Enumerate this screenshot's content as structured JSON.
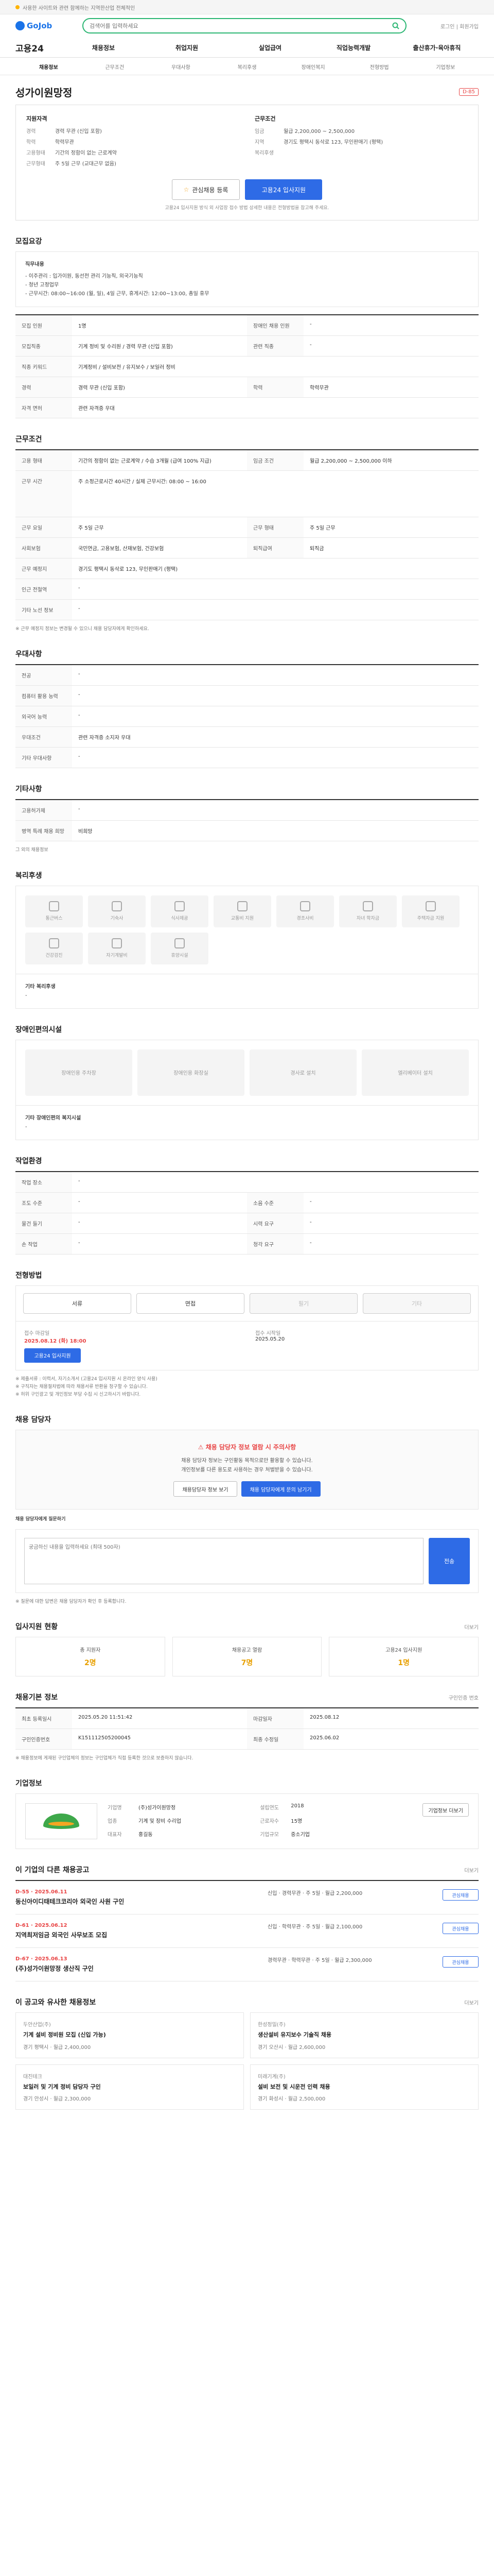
{
  "topbar": {
    "notice": "사용한 사이트와 관련 함께하는 지역한산업 전체적인"
  },
  "header": {
    "logo": "GoJob",
    "search_placeholder": "검색어를 입력하세요",
    "util": "로그인 | 회원가입"
  },
  "gnb": {
    "logo": "고용24",
    "items": [
      "채용정보",
      "취업지원",
      "실업급여",
      "직업능력개발",
      "출산휴가·육아휴직"
    ]
  },
  "subtabs": [
    "채용정보",
    "근무조건",
    "우대사항",
    "복리후생",
    "장애인복지",
    "전형방법",
    "기업정보"
  ],
  "title": {
    "text": "성가이원망정",
    "dday": "D-85"
  },
  "summary": {
    "left_h": "지원자격",
    "left": [
      {
        "k": "경력",
        "v": "경력 무관 (신입 포함)"
      },
      {
        "k": "학력",
        "v": "학력무관"
      },
      {
        "k": "고용형태",
        "v": "기간의 정함이 없는 근로계약"
      },
      {
        "k": "근무형태",
        "v": "주 5일 근무 (교대근무 없음)"
      }
    ],
    "right_h": "근무조건",
    "right": [
      {
        "k": "임금",
        "v": "월급 2,200,000 ~ 2,500,000"
      },
      {
        "k": "지역",
        "v": "경기도 평택시 동삭로 123, 무인판매기 (평택)"
      },
      {
        "k": "복리후생",
        "v": ""
      }
    ]
  },
  "buttons": {
    "interest": "관심채용 등록",
    "apply": "고용24 입사지원"
  },
  "notice_line": "고용24 입사지원 방식 외 사업장 접수 방법 상세한 내용은 전형방법을 참고해 주세요.",
  "sections": {
    "recruit": {
      "title": "모집요강",
      "boxed_h": "직무내용",
      "boxed_lines": [
        "- 이주관리 : 입가이원, 동선전 관리 기능직, 외국기능직",
        "- 청년 고정업무",
        "- 근무시간: 08:00~16:00 (월, 일), 4일 근무, 휴게시간: 12:00~13:00, 총일 휴무"
      ],
      "rows": [
        {
          "th": "모집 인원",
          "td": "1명",
          "th2": "장애인 채용 인원",
          "td2": "-"
        },
        {
          "th": "모집직종",
          "td": "기계 정비 및 수리원 / 경력 무관 (신입 포함)",
          "th2": "관련 직종",
          "td2": "-"
        },
        {
          "th": "직종 키워드",
          "td": "기계정비 / 설비보전 / 유지보수 / 보일러 정비"
        },
        {
          "th": "경력",
          "td": "경력 무관 (신입 포함)",
          "th2": "학력",
          "td2": "학력무관"
        },
        {
          "th": "자격 면허",
          "td": "관련 자격증 우대"
        }
      ]
    },
    "conditions": {
      "title": "근무조건",
      "rows": [
        {
          "th": "고용 형태",
          "td": "기간의 정함이 없는 근로계약 / 수습 3개월 (급여 100% 지급)",
          "th2": "임금 조건",
          "td2": "월급 2,200,000 ~ 2,500,000 이하"
        },
        {
          "th": "근무 시간",
          "td": "주 소정근로시간 40시간 / 실제 근무시간: 08:00 ~ 16:00"
        },
        {
          "th": "근무 요일",
          "td": "주 5일 근무",
          "th2": "근무 형태",
          "td2": "주 5일 근무"
        },
        {
          "th": "사회보험",
          "td": "국민연금, 고용보험, 산재보험, 건강보험",
          "th2": "퇴직급여",
          "td2": "퇴직금"
        },
        {
          "th": "근무 예정지",
          "td": "경기도 평택시 동삭로 123, 무인판매기 (평택)"
        },
        {
          "th": "인근 전철역",
          "td": "-"
        },
        {
          "th": "기타 노선 정보",
          "td": "-"
        }
      ],
      "fine": "※ 근무 예정지 정보는 변경될 수 있으니 채용 담당자에게 확인하세요."
    },
    "preference": {
      "title": "우대사항",
      "rows": [
        {
          "th": "전공",
          "td": "-"
        },
        {
          "th": "컴퓨터 활용 능력",
          "td": "-"
        },
        {
          "th": "외국어 능력",
          "td": "-"
        },
        {
          "th": "우대조건",
          "td": "관련 자격증 소지자 우대"
        },
        {
          "th": "기타 우대사항",
          "td": "-"
        }
      ]
    },
    "extra": {
      "title": "기타사항",
      "rows": [
        {
          "th": "고용허가제",
          "td": "-"
        },
        {
          "th": "병역 특례 채용 희망",
          "td": "비희망"
        }
      ],
      "link": "그 외의 채용정보"
    },
    "welfare": {
      "title": "복리후생",
      "items": [
        "통근버스",
        "기숙사",
        "식사제공",
        "교통비 지원",
        "경조사비",
        "자녀 학자금",
        "주택자금 지원",
        "건강검진",
        "자기계발비",
        "휴양시설"
      ],
      "sub": "기타 복리후생",
      "sub_val": "-"
    },
    "disabled": {
      "title": "장애인편의시설",
      "items": [
        "장애인용 주차장",
        "장애인용 화장실",
        "경사로 설치",
        "엘리베이터 설치"
      ],
      "sub": "기타 장애인편의 복지시설",
      "sub_val": "-"
    },
    "work_env": {
      "title": "작업환경",
      "rows": [
        {
          "th": "작업 장소",
          "td": "-"
        },
        {
          "th": "조도 수준",
          "td": "-",
          "th2": "소음 수준",
          "td2": "-"
        },
        {
          "th": "물건 들기",
          "td": "-",
          "th2": "시력 요구",
          "td2": "-"
        },
        {
          "th": "손 작업",
          "td": "-",
          "th2": "청각 요구",
          "td2": "-"
        }
      ]
    },
    "method": {
      "title": "전형방법",
      "options": [
        "서류",
        "면접",
        "필기",
        "기타"
      ],
      "deadline_h": "접수 마감일",
      "deadline": "2025.08.12 (화) 18:00",
      "start_h": "접수 시작일",
      "start": "2025.05.20",
      "apply": "고용24 입사지원",
      "fine": [
        "※ 제출서류 : 이력서, 자기소개서 (고용24 입사지원 시 온라인 양식 사용)",
        "※ 구직자는 채용절차법에 따라 채용서류 반환을 청구할 수 있습니다.",
        "※ 허위 구인광고 및 개인정보 부당 수집 시 신고하시기 바랍니다."
      ]
    },
    "inquiry": {
      "title": "채용 담당자",
      "alert": "채용 담당자 정보 열람 시 주의사항",
      "lines": [
        "채용 담당자 정보는 구인활동 목적으로만 활용할 수 있습니다.",
        "개인정보를 다른 용도로 사용하는 경우 처벌받을 수 있습니다."
      ],
      "btn1": "채용담당자 정보 보기",
      "btn2": "채용 담당자에게 문의 남기기",
      "qa_h": "채용 담당자에게 질문하기",
      "qa_placeholder": "궁금하신 내용을 입력하세요 (최대 500자)",
      "send": "전송",
      "fine": "※ 질문에 대한 답변은 채용 담당자가 확인 후 등록합니다."
    },
    "stats": {
      "title": "입사지원 현황",
      "more": "더보기",
      "items": [
        {
          "lbl": "총 지원자",
          "num": "2명"
        },
        {
          "lbl": "채용공고 열람",
          "num": "7명"
        },
        {
          "lbl": "고용24 입사지원",
          "num": "1명"
        }
      ]
    },
    "info": {
      "title": "채용기본 정보",
      "more": "구인인증 번호",
      "rows": [
        {
          "th": "최초 등록일시",
          "td": "2025.05.20 11:51:42",
          "th2": "마감일자",
          "td2": "2025.08.12"
        },
        {
          "th": "구인인증번호",
          "td": "K151112505200045",
          "th2": "최종 수정일",
          "td2": "2025.06.02"
        }
      ],
      "fine": "※ 채용정보에 게재된 구인업체의 정보는 구인업체가 직접 등록한 것으로 보증하지 않습니다."
    },
    "company": {
      "title": "기업정보",
      "rows": [
        {
          "k": "기업명",
          "v": "(주)성가이원망정",
          "k2": "설립연도",
          "v2": "2018"
        },
        {
          "k": "업종",
          "v": "기계 및 장비 수리업",
          "k2": "근로자수",
          "v2": "15명"
        },
        {
          "k": "대표자",
          "v": "홍길동",
          "k2": "기업규모",
          "v2": "중소기업"
        }
      ],
      "btn": "기업정보 더보기"
    },
    "same_jobs": {
      "title": "이 기업의 다른 채용공고",
      "more": "더보기",
      "items": [
        {
          "date": "D-55 · 2025.06.11",
          "title": "동신아이디태테크코리아 외국인 사원 구인",
          "info": "신입 · 경력무관 · 주 5일 · 월급 2,200,000",
          "btn": "관심채용"
        },
        {
          "date": "D-61 · 2025.06.12",
          "title": "지역최저임금 외국인 사무보조 모집",
          "info": "신입 · 학력무관 · 주 5일 · 월급 2,100,000",
          "btn": "관심채용"
        },
        {
          "date": "D-67 · 2025.06.13",
          "title": "(주)성가이원망정 생산직 구인",
          "info": "경력무관 · 학력무관 · 주 5일 · 월급 2,300,000",
          "btn": "관심채용"
        }
      ]
    },
    "recommend": {
      "title": "이 공고와 유사한 채용정보",
      "more": "더보기",
      "items": [
        {
          "co": "두안산업(주)",
          "title": "기계 설비 정비원 모집 (신입 가능)",
          "meta": "경기 평택시 · 월급 2,400,000"
        },
        {
          "co": "한성정밀(주)",
          "title": "생산설비 유지보수 기술직 채용",
          "meta": "경기 오산시 · 월급 2,600,000"
        },
        {
          "co": "대진테크",
          "title": "보일러 및 기계 정비 담당자 구인",
          "meta": "경기 안성시 · 월급 2,300,000"
        },
        {
          "co": "미래기계(주)",
          "title": "설비 보전 및 시운전 인력 채용",
          "meta": "경기 화성시 · 월급 2,500,000"
        }
      ]
    }
  }
}
